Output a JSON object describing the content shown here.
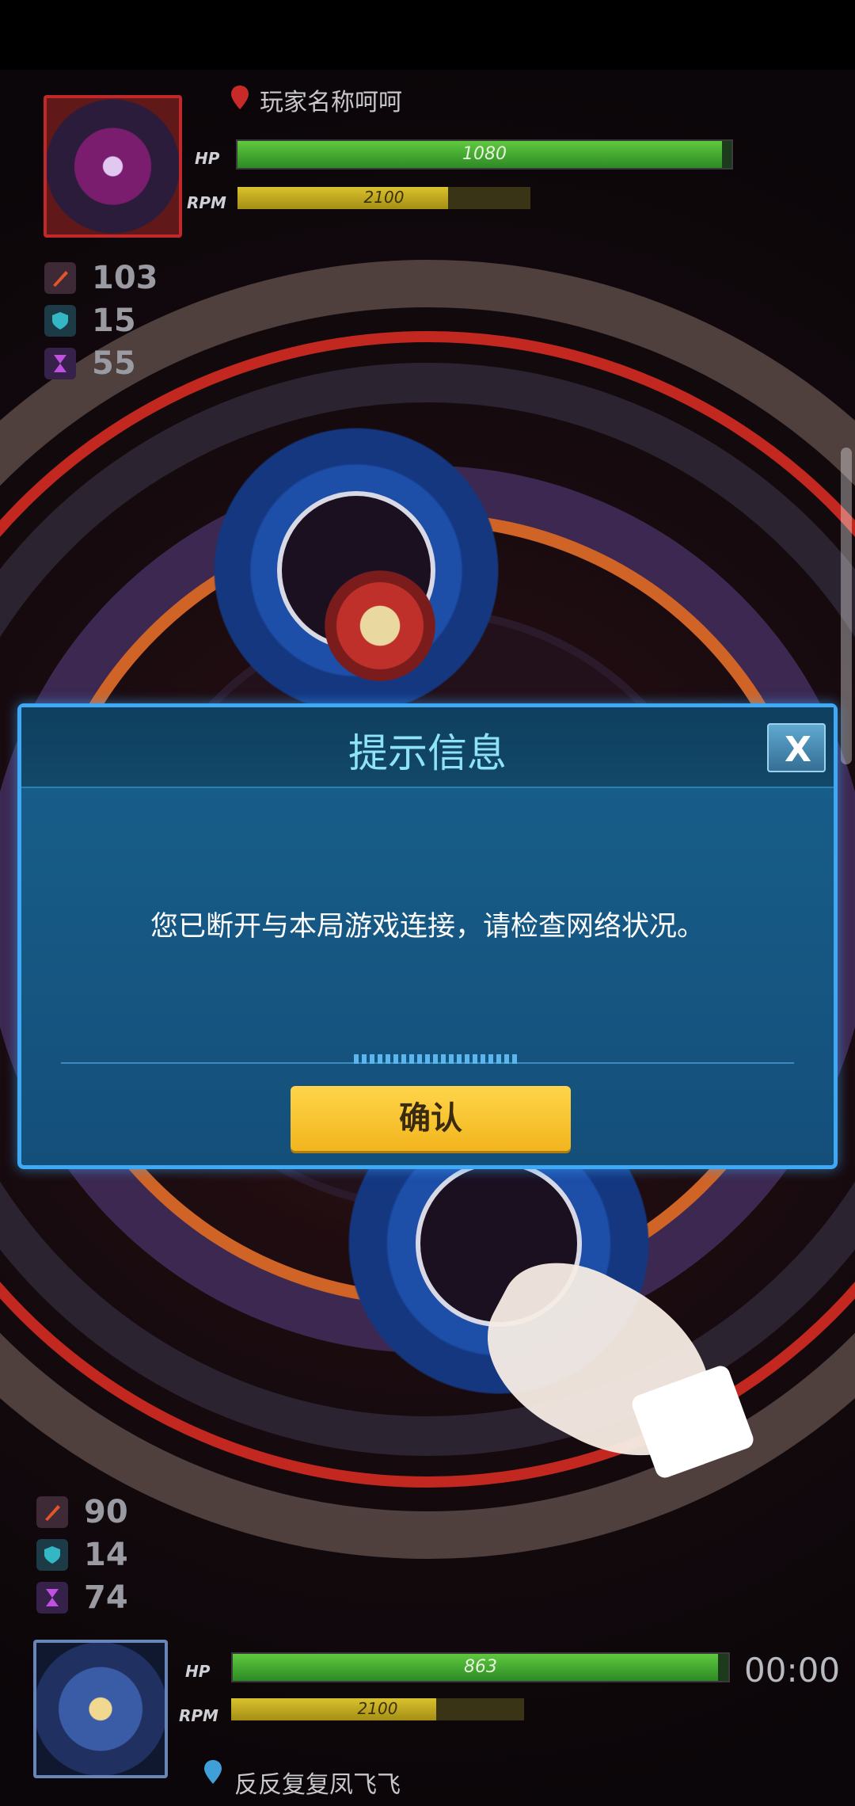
{
  "dialog": {
    "title": "提示信息",
    "message": "您已断开与本局游戏连接，请检查网络状况。",
    "confirm_label": "确认",
    "close_label": "X"
  },
  "opponent": {
    "name": "玩家名称呵呵",
    "hp_label": "HP",
    "hp_value": "1080",
    "hp_fraction": 0.98,
    "rpm_label": "RPM",
    "rpm_value": "2100",
    "rpm_fraction": 0.72,
    "stats": {
      "attack": "103",
      "defense": "15",
      "stamina": "55"
    }
  },
  "player": {
    "name": "反反复复凤飞飞",
    "hp_label": "HP",
    "hp_value": "863",
    "hp_fraction": 0.98,
    "rpm_label": "RPM",
    "rpm_value": "2100",
    "rpm_fraction": 0.7,
    "stats": {
      "attack": "90",
      "defense": "14",
      "stamina": "74"
    }
  },
  "timer": "00:00",
  "colors": {
    "hp": "#4bb338",
    "rpm": "#d4bb26",
    "dialog_border": "#3fa9f5",
    "confirm": "#f7c531",
    "title": "#8ee3f6"
  }
}
